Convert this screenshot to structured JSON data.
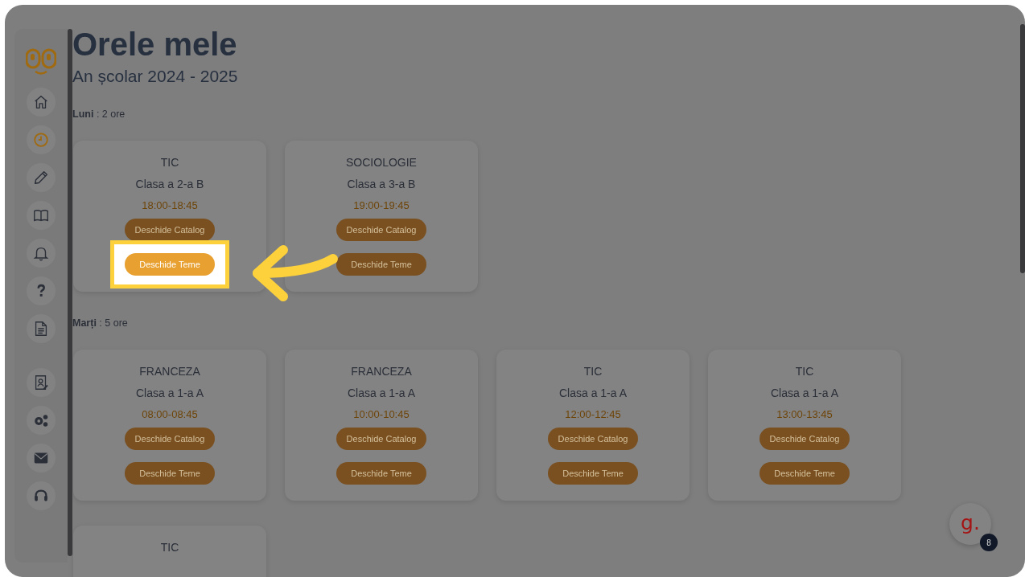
{
  "page": {
    "title": "Orele mele",
    "subtitle": "An școlar 2024 - 2025"
  },
  "sidebar": {
    "items": [
      {
        "selected": false
      },
      {
        "selected": true
      },
      {
        "selected": false
      },
      {
        "selected": false
      },
      {
        "selected": false
      },
      {
        "selected": false
      },
      {
        "selected": false
      },
      {
        "selected": false
      },
      {
        "selected": false
      },
      {
        "selected": false
      },
      {
        "selected": false
      }
    ]
  },
  "days": [
    {
      "name": "Luni",
      "count": ": 2 ore",
      "lessons": [
        {
          "subject": "TIC",
          "class": "Clasa a 2-a B",
          "time": "18:00-18:45",
          "buttons": [
            {
              "label": "Deschide Catalog",
              "highlighted": false
            },
            {
              "label": "Deschide Teme",
              "highlighted": true
            }
          ]
        },
        {
          "subject": "SOCIOLOGIE",
          "class": "Clasa a 3-a B",
          "time": "19:00-19:45",
          "buttons": [
            {
              "label": "Deschide Catalog",
              "highlighted": false
            },
            {
              "label": "Deschide Teme",
              "highlighted": false
            }
          ]
        }
      ]
    },
    {
      "name": "Marți",
      "count": ": 5 ore",
      "lessons": [
        {
          "subject": "FRANCEZA",
          "class": "Clasa a 1-a A",
          "time": "08:00-08:45",
          "buttons": [
            {
              "label": "Deschide Catalog",
              "highlighted": false
            },
            {
              "label": "Deschide Teme",
              "highlighted": false
            }
          ]
        },
        {
          "subject": "FRANCEZA",
          "class": "Clasa a 1-a A",
          "time": "10:00-10:45",
          "buttons": [
            {
              "label": "Deschide Catalog",
              "highlighted": false
            },
            {
              "label": "Deschide Teme",
              "highlighted": false
            }
          ]
        },
        {
          "subject": "TIC",
          "class": "Clasa a 1-a A",
          "time": "12:00-12:45",
          "buttons": [
            {
              "label": "Deschide Catalog",
              "highlighted": false
            },
            {
              "label": "Deschide Teme",
              "highlighted": false
            }
          ]
        },
        {
          "subject": "TIC",
          "class": "Clasa a 1-a A",
          "time": "13:00-13:45",
          "buttons": [
            {
              "label": "Deschide Catalog",
              "highlighted": false
            },
            {
              "label": "Deschide Teme",
              "highlighted": false
            }
          ]
        }
      ]
    },
    {
      "lessons": [
        {
          "subject": "TIC"
        }
      ]
    }
  ],
  "chat": {
    "logo": "g.",
    "badge": "8"
  }
}
